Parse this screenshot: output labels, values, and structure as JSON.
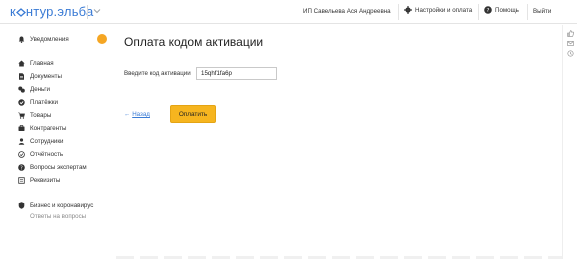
{
  "header": {
    "logo": {
      "brand": "к",
      "rest": "нтур.",
      "suffix": "эльба"
    },
    "user": "ИП Савельева Ася Андреевна",
    "settings_label": "Настройки и оплата",
    "help_label": "Помощь",
    "exit_label": "Выйти"
  },
  "sidebar": {
    "items": [
      {
        "label": "Уведомления",
        "icon": "bell-icon"
      },
      {
        "label": "Главная",
        "icon": "home-icon"
      },
      {
        "label": "Документы",
        "icon": "document-icon"
      },
      {
        "label": "Деньги",
        "icon": "money-icon"
      },
      {
        "label": "Платёжки",
        "icon": "payment-icon"
      },
      {
        "label": "Товары",
        "icon": "cart-icon"
      },
      {
        "label": "Контрагенты",
        "icon": "contractors-icon"
      },
      {
        "label": "Сотрудники",
        "icon": "employees-icon"
      },
      {
        "label": "Отчётность",
        "icon": "reports-icon"
      },
      {
        "label": "Вопросы экспертам",
        "icon": "question-icon"
      },
      {
        "label": "Реквизиты",
        "icon": "requisites-icon"
      },
      {
        "label": "Бизнес и коронавирус",
        "icon": "shield-icon"
      }
    ],
    "sub_label": "Ответы на вопросы",
    "badge_color": "#f5a623"
  },
  "main": {
    "title": "Оплата кодом активации",
    "field_label": "Введите код активации",
    "field_value": "15qhf1fa6p",
    "back_label": "Назад",
    "back_arrow": "←",
    "pay_button": "Оплатить"
  },
  "colors": {
    "accent": "#3a7bd5",
    "button": "#f6b51f"
  }
}
